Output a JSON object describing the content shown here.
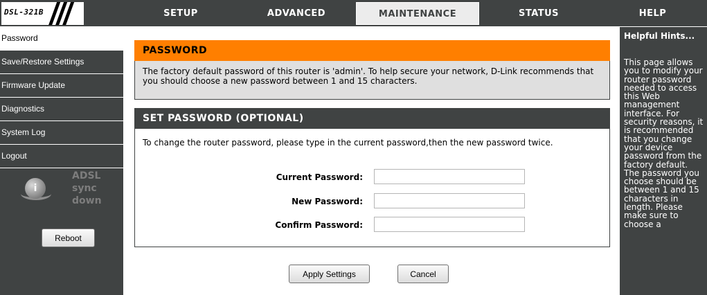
{
  "header": {
    "model": "DSL-321B",
    "tabs": [
      {
        "label": "SETUP",
        "active": false
      },
      {
        "label": "ADVANCED",
        "active": false
      },
      {
        "label": "MAINTENANCE",
        "active": true
      },
      {
        "label": "STATUS",
        "active": false
      },
      {
        "label": "HELP",
        "active": false
      }
    ]
  },
  "sidebar": {
    "items": [
      {
        "label": "Password",
        "active": true
      },
      {
        "label": "Save/Restore Settings",
        "active": false
      },
      {
        "label": "Firmware Update",
        "active": false
      },
      {
        "label": "Diagnostics",
        "active": false
      },
      {
        "label": "System Log",
        "active": false
      },
      {
        "label": "Logout",
        "active": false
      }
    ],
    "adsl_status": {
      "line1": "ADSL",
      "line2": "sync",
      "line3": "down",
      "icon": "info-icon"
    },
    "reboot_label": "Reboot"
  },
  "password_section": {
    "title": "PASSWORD",
    "description": "The factory default password of this router is 'admin'. To help secure your network, D-Link recommends that you should choose a new password between 1 and 15 characters."
  },
  "set_password_section": {
    "title": "SET PASSWORD (OPTIONAL)",
    "description": "To change the router password, please type in the current password,then the new password twice.",
    "fields": [
      {
        "label": "Current Password:",
        "value": ""
      },
      {
        "label": "New Password:",
        "value": ""
      },
      {
        "label": "Confirm Password:",
        "value": ""
      }
    ]
  },
  "actions": {
    "apply_label": "Apply Settings",
    "cancel_label": "Cancel"
  },
  "hints": {
    "title": "Helpful Hints...",
    "body": "This page allows you to modify your router password needed to access this Web management interface. For security reasons, it is recommended that you change your device password from the factory default. The password you choose should be between 1 and 15 characters in length. Please make sure to choose a"
  },
  "colors": {
    "bar": "#404343",
    "accent": "#ff7f00",
    "panel": "#dfdfdf"
  }
}
